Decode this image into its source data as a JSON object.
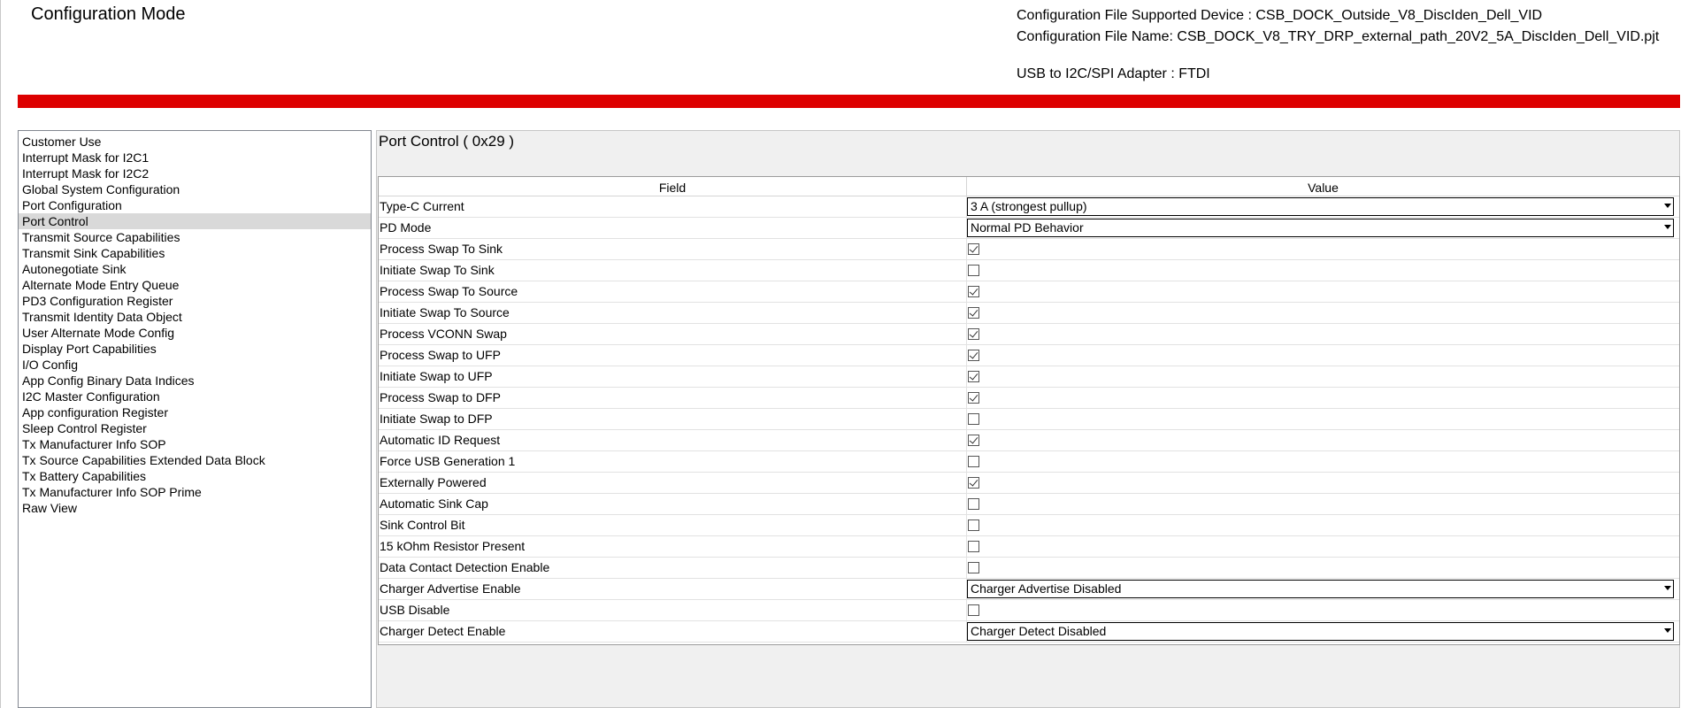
{
  "header": {
    "mode_title": "Configuration Mode",
    "supported_device": "Configuration File Supported Device : CSB_DOCK_Outside_V8_DiscIden_Dell_VID",
    "file_name": "Configuration File Name: CSB_DOCK_V8_TRY_DRP_external_path_20V2_5A_DiscIden_Dell_VID.pjt",
    "adapter": "USB to I2C/SPI Adapter : FTDI"
  },
  "colors": {
    "accent_bar": "#dd0000",
    "selected_item": "#d9d9d9"
  },
  "sidebar": {
    "items": [
      {
        "label": "Customer Use",
        "selected": false
      },
      {
        "label": "Interrupt Mask for I2C1",
        "selected": false
      },
      {
        "label": "Interrupt Mask for I2C2",
        "selected": false
      },
      {
        "label": "Global System Configuration",
        "selected": false
      },
      {
        "label": "Port Configuration",
        "selected": false
      },
      {
        "label": "Port Control",
        "selected": true
      },
      {
        "label": "Transmit Source Capabilities",
        "selected": false
      },
      {
        "label": "Transmit Sink Capabilities",
        "selected": false
      },
      {
        "label": "Autonegotiate Sink",
        "selected": false
      },
      {
        "label": "Alternate Mode Entry Queue",
        "selected": false
      },
      {
        "label": "PD3 Configuration Register",
        "selected": false
      },
      {
        "label": "Transmit Identity Data Object",
        "selected": false
      },
      {
        "label": "User Alternate Mode Config",
        "selected": false
      },
      {
        "label": "Display Port Capabilities",
        "selected": false
      },
      {
        "label": "I/O Config",
        "selected": false
      },
      {
        "label": "App Config Binary Data Indices",
        "selected": false
      },
      {
        "label": "I2C Master Configuration",
        "selected": false
      },
      {
        "label": "App configuration Register",
        "selected": false
      },
      {
        "label": "Sleep Control Register",
        "selected": false
      },
      {
        "label": "Tx Manufacturer Info SOP",
        "selected": false
      },
      {
        "label": "Tx Source Capabilities Extended Data Block",
        "selected": false
      },
      {
        "label": "Tx Battery Capabilities",
        "selected": false
      },
      {
        "label": "Tx Manufacturer Info SOP Prime",
        "selected": false
      },
      {
        "label": "Raw View",
        "selected": false
      }
    ]
  },
  "main": {
    "section_title": "Port Control  ( 0x29 )",
    "columns": {
      "field": "Field",
      "value": "Value"
    },
    "rows": [
      {
        "field": "Type-C Current",
        "type": "dropdown",
        "value": "3 A (strongest pullup)"
      },
      {
        "field": "PD Mode",
        "type": "dropdown",
        "value": "Normal PD Behavior"
      },
      {
        "field": "Process Swap To Sink",
        "type": "checkbox",
        "checked": true
      },
      {
        "field": "Initiate Swap To Sink",
        "type": "checkbox",
        "checked": false
      },
      {
        "field": "Process Swap To Source",
        "type": "checkbox",
        "checked": true
      },
      {
        "field": "Initiate Swap To Source",
        "type": "checkbox",
        "checked": true
      },
      {
        "field": "Process VCONN Swap",
        "type": "checkbox",
        "checked": true
      },
      {
        "field": "Process Swap to UFP",
        "type": "checkbox",
        "checked": true
      },
      {
        "field": "Initiate Swap to UFP",
        "type": "checkbox",
        "checked": true
      },
      {
        "field": "Process Swap to DFP",
        "type": "checkbox",
        "checked": true
      },
      {
        "field": "Initiate Swap to DFP",
        "type": "checkbox",
        "checked": false
      },
      {
        "field": "Automatic ID Request",
        "type": "checkbox",
        "checked": true
      },
      {
        "field": "Force USB Generation 1",
        "type": "checkbox",
        "checked": false
      },
      {
        "field": "Externally Powered",
        "type": "checkbox",
        "checked": true
      },
      {
        "field": "Automatic Sink Cap",
        "type": "checkbox",
        "checked": false
      },
      {
        "field": "Sink Control Bit",
        "type": "checkbox",
        "checked": false
      },
      {
        "field": "15 kOhm Resistor Present",
        "type": "checkbox",
        "checked": false
      },
      {
        "field": "Data Contact Detection Enable",
        "type": "checkbox",
        "checked": false
      },
      {
        "field": "Charger Advertise Enable",
        "type": "dropdown",
        "value": "Charger Advertise Disabled"
      },
      {
        "field": "USB Disable",
        "type": "checkbox",
        "checked": false
      },
      {
        "field": "Charger Detect Enable",
        "type": "dropdown",
        "value": "Charger Detect Disabled"
      }
    ]
  }
}
